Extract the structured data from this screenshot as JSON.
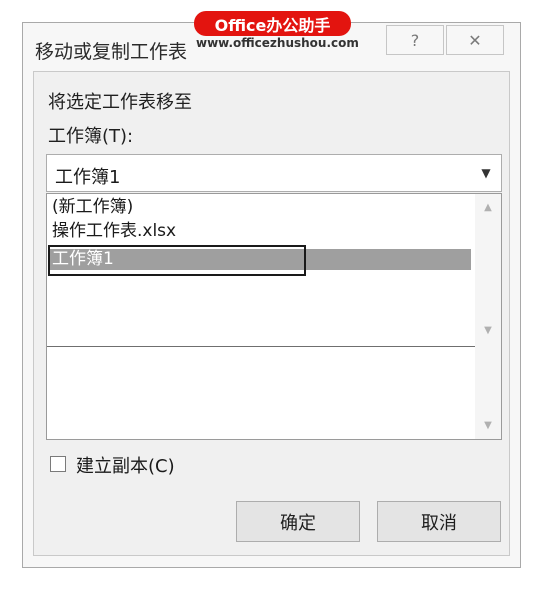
{
  "window": {
    "title": "移动或复制工作表",
    "help_glyph": "?",
    "close_glyph": "✕"
  },
  "watermark": {
    "badge": "Office办公助手",
    "url": "www.officezhushou.com"
  },
  "dialog": {
    "move_label": "将选定工作表移至",
    "workbook_label": "工作簿(T):",
    "combo_value": "工作簿1",
    "combo_arrow": "▼",
    "list_items": [
      "(新工作簿)",
      "操作工作表.xlsx",
      "工作簿1"
    ],
    "selected_index": 2,
    "scroll_up": "▲",
    "scroll_down": "▼",
    "checkbox_label": "建立副本(C)",
    "checkbox_checked": false,
    "ok_label": "确定",
    "cancel_label": "取消"
  }
}
